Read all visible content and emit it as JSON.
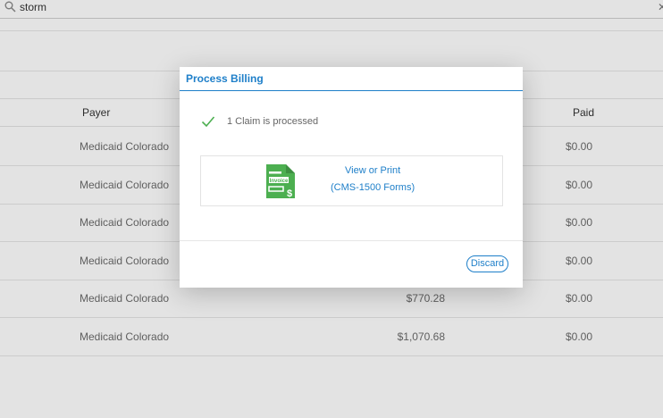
{
  "search": {
    "value": "storm",
    "clear_icon": "close-icon"
  },
  "table": {
    "headers": {
      "payer": "Payer",
      "paid": "Paid"
    },
    "rows": [
      {
        "payer": "Medicaid Colorado",
        "amount": "",
        "paid": "$0.00"
      },
      {
        "payer": "Medicaid Colorado",
        "amount": "",
        "paid": "$0.00"
      },
      {
        "payer": "Medicaid Colorado",
        "amount": "",
        "paid": "$0.00"
      },
      {
        "payer": "Medicaid Colorado",
        "amount": "",
        "paid": "$0.00"
      },
      {
        "payer": "Medicaid Colorado",
        "amount": "$770.28",
        "paid": "$0.00"
      },
      {
        "payer": "Medicaid Colorado",
        "amount": "$1,070.68",
        "paid": "$0.00"
      }
    ]
  },
  "modal": {
    "title": "Process Billing",
    "status": "1 Claim is processed",
    "action": {
      "line1": "View or Print",
      "line2": "(CMS-1500 Forms)",
      "icon": "invoice-icon",
      "icon_label": "Invoice",
      "icon_symbol": "$"
    },
    "discard_label": "Discard",
    "colors": {
      "accent": "#1e7fc9",
      "success": "#4caf50"
    }
  }
}
